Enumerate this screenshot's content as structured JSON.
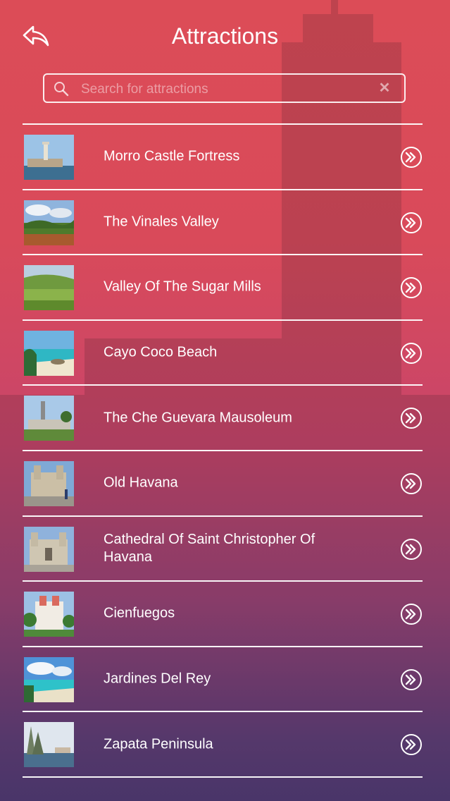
{
  "header": {
    "title": "Attractions",
    "back_icon": "back-arrow-icon"
  },
  "search": {
    "placeholder": "Search for attractions",
    "value": "",
    "search_icon": "search-icon",
    "clear_icon": "clear-icon",
    "clear_glyph": "✕"
  },
  "colors": {
    "gradient_top": "#dc4c57",
    "gradient_bottom": "#4d3b78",
    "text": "#ffffff"
  },
  "attractions": [
    {
      "label": "Morro Castle Fortress",
      "thumb": "castle"
    },
    {
      "label": "The Vinales Valley",
      "thumb": "valley"
    },
    {
      "label": "Valley Of The Sugar Mills",
      "thumb": "fields"
    },
    {
      "label": "Cayo Coco Beach",
      "thumb": "beach"
    },
    {
      "label": "The Che Guevara Mausoleum",
      "thumb": "monument"
    },
    {
      "label": "Old Havana",
      "thumb": "cathedral"
    },
    {
      "label": "Cathedral Of Saint Christopher Of Havana",
      "thumb": "cathedral2"
    },
    {
      "label": "Cienfuegos",
      "thumb": "palace"
    },
    {
      "label": "Jardines Del Rey",
      "thumb": "beach2"
    },
    {
      "label": "Zapata Peninsula",
      "thumb": "swamp"
    }
  ]
}
